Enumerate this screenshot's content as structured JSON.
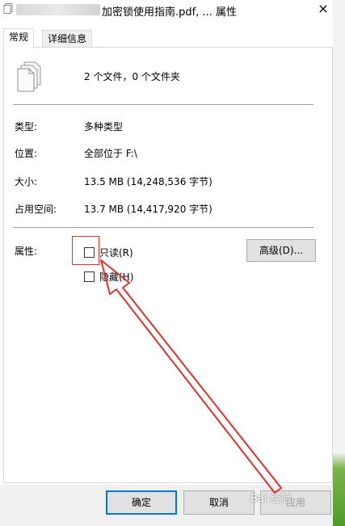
{
  "window": {
    "title": "加密锁使用指南.pdf, ... 属性",
    "close_icon": "×"
  },
  "tabs": [
    {
      "label": "常规"
    },
    {
      "label": "详细信息"
    }
  ],
  "summary": "2 个文件，0 个文件夹",
  "properties": {
    "type_label": "类型:",
    "type_value": "多种类型",
    "location_label": "位置:",
    "location_value": "全部位于 F:\\",
    "size_label": "大小:",
    "size_value": "13.5 MB (14,248,536 字节)",
    "disk_label": "占用空间:",
    "disk_value": "13.7 MB (14,417,920 字节)"
  },
  "attributes": {
    "label": "属性:",
    "readonly_label": "只读(R)",
    "hidden_label": "隐藏(H)",
    "advanced_button": "高级(D)..."
  },
  "buttons": {
    "ok": "确定",
    "cancel": "取消",
    "apply": "应用"
  },
  "watermark": "Bai 经验",
  "icons": {
    "title_icon": "document-icon",
    "file_stack_icon": "file-stack-icon",
    "close_icon": "close-icon"
  },
  "colors": {
    "annotation": "#e03030",
    "ok_border": "#0078d7"
  }
}
